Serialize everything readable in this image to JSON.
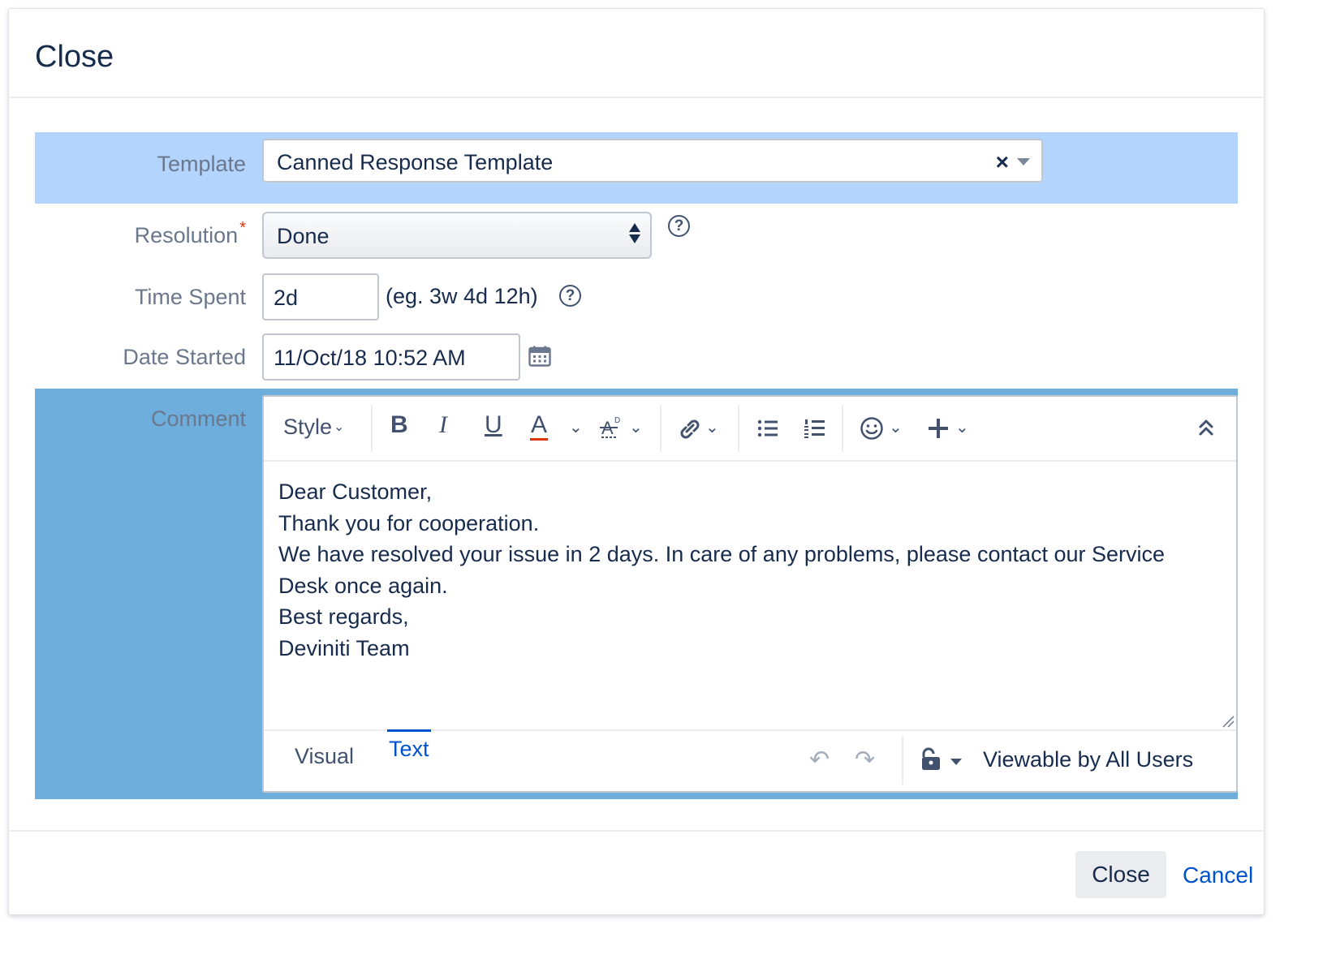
{
  "dialog": {
    "title": "Close"
  },
  "template": {
    "label": "Template",
    "value": "Canned Response Template",
    "clear_symbol": "×"
  },
  "resolution": {
    "label": "Resolution",
    "required_marker": "*",
    "value": "Done",
    "help_symbol": "?"
  },
  "time_spent": {
    "label": "Time Spent",
    "value": "2d",
    "hint": "(eg. 3w 4d 12h)",
    "help_symbol": "?"
  },
  "date_started": {
    "label": "Date Started",
    "value": "11/Oct/18 10:52 AM"
  },
  "comment": {
    "label": "Comment",
    "toolbar": {
      "style_label": "Style",
      "bold": "B",
      "italic": "I",
      "underline": "U",
      "text_color": "A",
      "chevron": "⌄",
      "collapse": "⌃"
    },
    "body_lines": [
      "Dear Customer,",
      "Thank you for cooperation.",
      "We have resolved your issue in 2 days. In care of any problems, please contact our Service",
      "Desk once again.",
      "Best regards,",
      "Deviniti Team"
    ],
    "tabs": {
      "visual": "Visual",
      "text": "Text",
      "active": "Text"
    },
    "undo_symbol": "↶",
    "redo_symbol": "↷",
    "visibility": "Viewable by All Users"
  },
  "footer": {
    "close_label": "Close",
    "cancel_label": "Cancel"
  },
  "colors": {
    "template_row_bg": "#b3d4fd",
    "comment_row_bg": "#6eaedd",
    "link_blue": "#0052cc",
    "required_red": "#de350b",
    "text_color_underline": "#de350b"
  }
}
